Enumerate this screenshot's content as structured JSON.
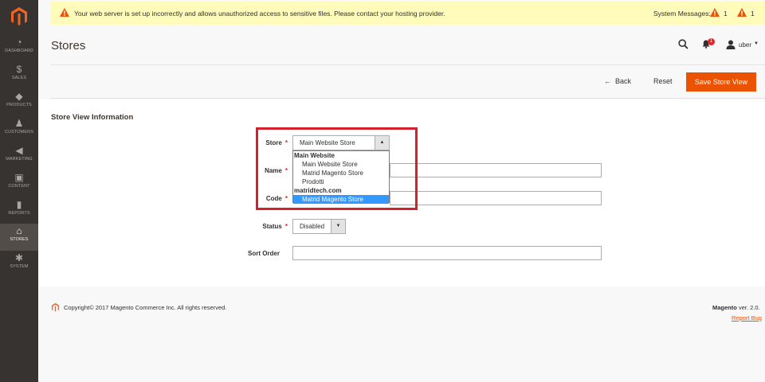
{
  "sidebar": {
    "items": [
      {
        "label": "DASHBOARD",
        "icon": "dashboard-icon",
        "glyph": "◔"
      },
      {
        "label": "SALES",
        "icon": "dollar-icon",
        "glyph": "$"
      },
      {
        "label": "PRODUCTS",
        "icon": "cube-icon",
        "glyph": "◆"
      },
      {
        "label": "CUSTOMERS",
        "icon": "person-icon",
        "glyph": "♟"
      },
      {
        "label": "MARKETING",
        "icon": "megaphone-icon",
        "glyph": "◀"
      },
      {
        "label": "CONTENT",
        "icon": "layout-icon",
        "glyph": "▣"
      },
      {
        "label": "REPORTS",
        "icon": "bar-chart-icon",
        "glyph": "▮"
      },
      {
        "label": "STORES",
        "icon": "store-icon",
        "glyph": "⌂"
      },
      {
        "label": "SYSTEM",
        "icon": "gear-icon",
        "glyph": "✱"
      }
    ]
  },
  "system_bar": {
    "message": "Your web server is set up incorrectly and allows unauthorized access to sensitive files. Please contact your hosting provider.",
    "label": "System Messages:",
    "count_critical": "1",
    "count_major": "1"
  },
  "header": {
    "title": "Stores",
    "notification_count": "1",
    "username": "uber"
  },
  "actions": {
    "back": "Back",
    "reset": "Reset",
    "save": "Save Store View"
  },
  "form": {
    "section_title": "Store View Information",
    "store_label": "Store",
    "store_value": "Main Website Store",
    "name_label": "Name",
    "code_label": "Code",
    "status_label": "Status",
    "status_value": "Disabled",
    "sort_label": "Sort Order",
    "store_options": [
      {
        "text": "Main Website",
        "type": "group"
      },
      {
        "text": "Main Website Store",
        "type": "item"
      },
      {
        "text": "Matrid Magento Store",
        "type": "item"
      },
      {
        "text": "Prodotti",
        "type": "item"
      },
      {
        "text": "matridtech.com",
        "type": "group"
      },
      {
        "text": "Matrid Magento Store",
        "type": "item",
        "selected": true
      }
    ]
  },
  "footer": {
    "copyright": "Copyright© 2017 Magento Commerce Inc. All rights reserved.",
    "brand": "Magento",
    "version": "ver. 2.0.",
    "report": "Report Bug"
  },
  "colors": {
    "accent": "#eb5202",
    "sidebar": "#373330",
    "highlight_box": "#d3222c",
    "selection": "#3399ff"
  }
}
